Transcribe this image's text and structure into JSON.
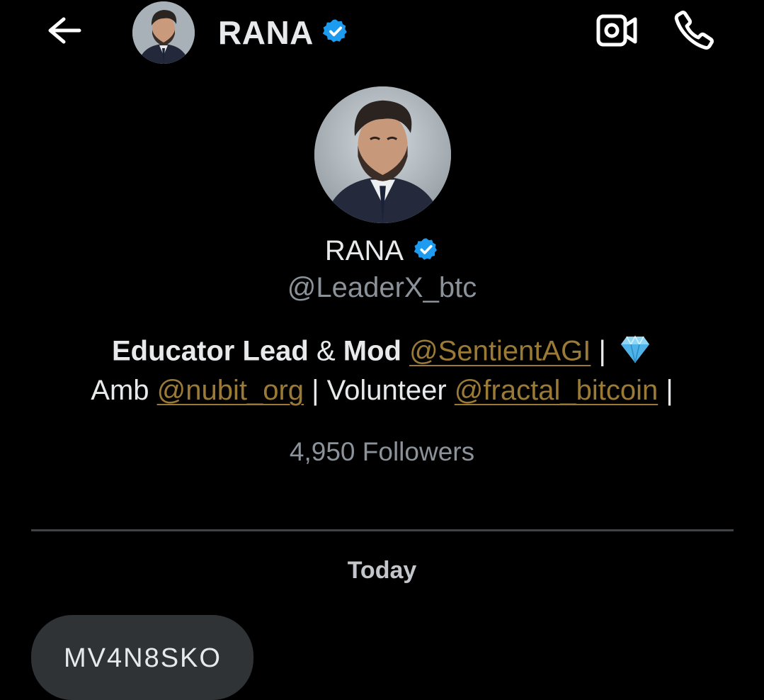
{
  "header": {
    "back_icon": "arrow-left-icon",
    "name": "RANA",
    "verified_icon": "verified-badge-icon",
    "video_icon": "video-camera-icon",
    "call_icon": "phone-icon"
  },
  "profile": {
    "name": "RANA",
    "handle": "@LeaderX_btc",
    "bio": {
      "line1": {
        "t1": "Educator Lead",
        "t2": " & ",
        "t3": "Mod",
        "sp": " ",
        "link1": "@SentientAGI",
        "t4": " | ",
        "emoji_icon": "gem-icon"
      },
      "line2": {
        "t1": "Amb ",
        "link1": "@nubit_org",
        "t2": " | Volunteer ",
        "link2": "@fractal_bitcoin",
        "t3": " |"
      }
    },
    "followers": "4,950 Followers"
  },
  "conversation": {
    "date_separator": "Today",
    "message_text": "MV4N8SKO"
  },
  "colors": {
    "background": "#000000",
    "text": "#e7e9ea",
    "muted": "#8b9299",
    "link": "#9b7a35",
    "verified": "#1d9bf0",
    "bubble": "#2f3336"
  }
}
